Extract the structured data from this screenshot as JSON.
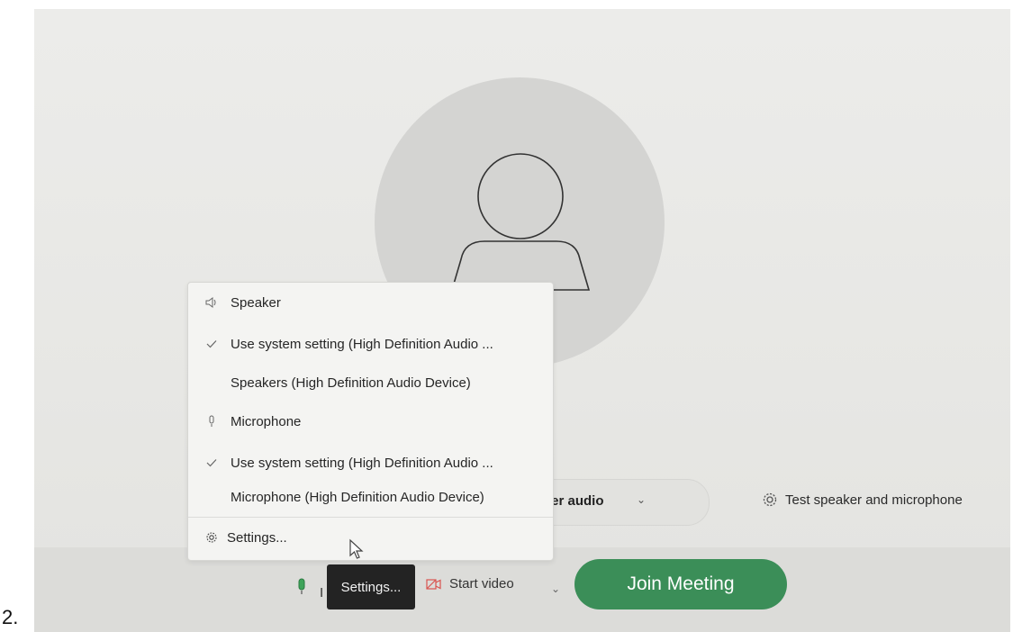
{
  "step_number": "2.",
  "audio_menu": {
    "speaker_header": "Speaker",
    "speaker_system_setting": "Use system setting (High Definition Audio ...",
    "speaker_device": "Speakers (High Definition Audio Device)",
    "microphone_header": "Microphone",
    "microphone_system_setting": "Use system setting (High Definition Audio ...",
    "microphone_device": "Microphone (High Definition Audio Device)",
    "settings_label": "Settings..."
  },
  "audio_connection": {
    "label": "uter audio",
    "caret": "⌄"
  },
  "test_speaker_label": "Test speaker and microphone",
  "toolbar": {
    "mute_label_partial": "I",
    "tooltip_label": "Settings...",
    "video_label": "Start video",
    "video_caret": "⌄",
    "join_label": "Join Meeting"
  },
  "colors": {
    "join_button": "#3b8e58",
    "tooltip_bg": "#232323",
    "mic_active": "#3fa45a",
    "video_off": "#d9534f"
  },
  "icons": {
    "speaker": "speaker-icon",
    "microphone": "microphone-icon",
    "check": "check-icon",
    "settings": "gear-icon",
    "video": "video-off-icon",
    "cursor": "mouse-cursor-icon"
  }
}
